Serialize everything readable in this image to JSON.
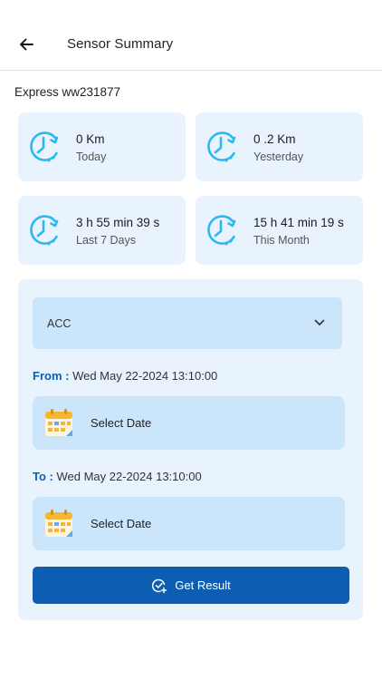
{
  "header": {
    "title": "Sensor Summary",
    "back_icon": "arrow-left-icon"
  },
  "vehicle": {
    "name": "Express ww231877"
  },
  "cards": [
    {
      "value": "0 Km",
      "label": "Today",
      "icon": "clock-icon"
    },
    {
      "value": "0 .2 Km",
      "label": "Yesterday",
      "icon": "clock-icon"
    },
    {
      "value": "3 h 55 min 39 s",
      "label": "Last 7 Days",
      "icon": "clock-icon"
    },
    {
      "value": "15 h 41 min 19 s",
      "label": "This Month",
      "icon": "clock-icon"
    }
  ],
  "form": {
    "sensor_select": {
      "value": "ACC",
      "icon": "chevron-down-icon"
    },
    "from": {
      "label": "From :",
      "value": "Wed May 22-2024 13:10:00",
      "button_label": "Select Date",
      "icon": "calendar-icon"
    },
    "to": {
      "label": "To :",
      "value": "Wed May 22-2024 13:10:00",
      "button_label": "Select Date",
      "icon": "calendar-icon"
    },
    "submit": {
      "label": "Get Result",
      "icon": "check-add-icon"
    }
  },
  "colors": {
    "primary": "#0d5eb3",
    "card_bg": "#e9f3fd",
    "field_bg": "#cbe5fa",
    "clock_accent": "#2bb8f0"
  }
}
